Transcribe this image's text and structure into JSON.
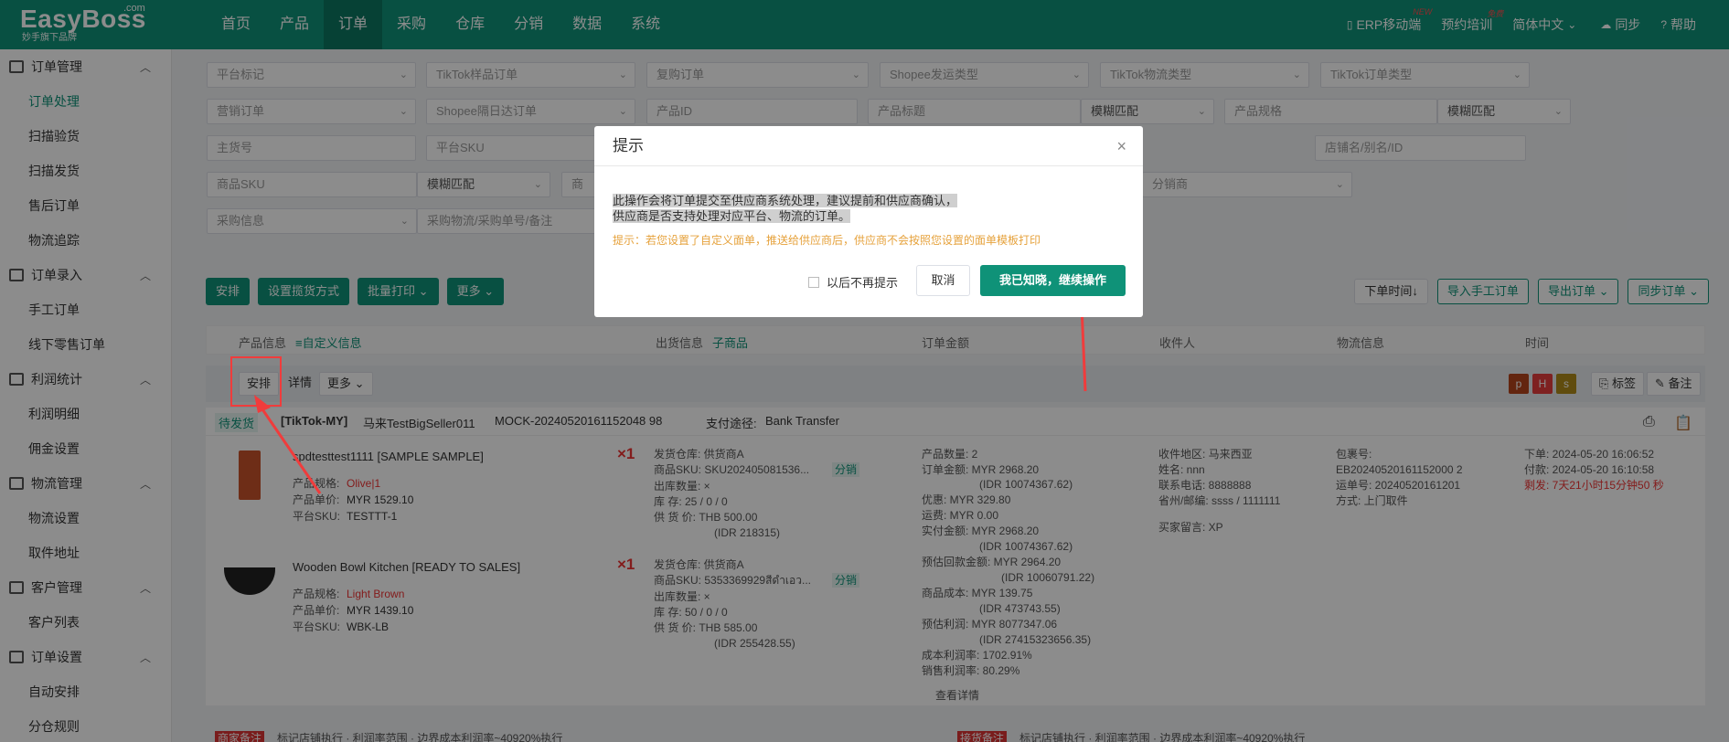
{
  "logo": {
    "name": "EasyBoss",
    "com": ".com",
    "sub": "妙手旗下品牌"
  },
  "nav": [
    "首页",
    "产品",
    "订单",
    "采购",
    "仓库",
    "分销",
    "数据",
    "系统"
  ],
  "topright": {
    "erp": "ERP移动端",
    "erp_badge": "NEW",
    "train": "预约培训",
    "train_badge": "免费",
    "lang": "简体中文",
    "sync": "同步",
    "help": "帮助"
  },
  "sidebar": [
    {
      "group": "订单管理",
      "items": [
        "订单处理",
        "扫描验货",
        "扫描发货",
        "售后订单",
        "物流追踪"
      ]
    },
    {
      "group": "订单录入",
      "items": [
        "手工订单",
        "线下零售订单"
      ]
    },
    {
      "group": "利润统计",
      "items": [
        "利润明细",
        "佣金设置"
      ]
    },
    {
      "group": "物流管理",
      "items": [
        "物流设置",
        "取件地址"
      ]
    },
    {
      "group": "客户管理",
      "items": [
        "客户列表"
      ]
    },
    {
      "group": "订单设置",
      "items": [
        "自动安排",
        "分仓规则"
      ]
    }
  ],
  "filters": {
    "r1": [
      "平台标记",
      "TikTok样品订单",
      "复购订单",
      "Shopee发运类型",
      "TikTok物流类型",
      "TikTok订单类型"
    ],
    "r2": [
      "营销订单",
      "Shopee隔日达订单",
      "产品ID",
      "产品标题",
      "模糊匹配",
      "产品规格",
      "模糊匹配"
    ],
    "r3": [
      "主货号",
      "平台SKU",
      "店铺名/别名/ID"
    ],
    "r4": [
      "商品SKU",
      "模糊匹配",
      "商",
      "分销商"
    ],
    "r5": [
      "采购信息",
      "采购物流/采购单号/备注"
    ]
  },
  "actions": [
    "安排",
    "设置揽货方式",
    "批量打印",
    "更多"
  ],
  "right_actions": [
    "下单时间↓",
    "导入手工订单",
    "导出订单",
    "同步订单"
  ],
  "table_head": {
    "product": "产品信息",
    "custom": "≡自定义信息",
    "ship": "出货信息",
    "sub": "子商品",
    "amount": "订单金额",
    "receiver": "收件人",
    "logistics": "物流信息",
    "time": "时间"
  },
  "row_buttons": {
    "arrange": "安排",
    "detail": "详情",
    "more": "更多",
    "label": "标签",
    "remark": "备注"
  },
  "tags": [
    {
      "t": "p",
      "c": "#b5441c"
    },
    {
      "t": "H",
      "c": "#e63c3c"
    },
    {
      "t": "s",
      "c": "#b08a1a"
    }
  ],
  "order": {
    "status": "待发货",
    "platform": "[TikTok-MY]",
    "seller": "马来TestBigSeller011",
    "id": "MOCK-20240520161152048 98",
    "pay_label": "支付途径:",
    "pay": "Bank Transfer"
  },
  "items": [
    {
      "title": "spdtesttest1111 [SAMPLE SAMPLE]",
      "qty": "×1",
      "spec_label": "产品规格:",
      "spec": "Olive|1",
      "price_label": "产品单价:",
      "price": "MYR 1529.10",
      "sku_label": "平台SKU:",
      "sku": "TESTTT-1",
      "ship": [
        "发货仓库: 供货商A",
        "商品SKU: SKU202405081536...",
        "出库数量: ×",
        "库 存: 25 / 0 / 0",
        "供 货 价: THB 500.00",
        "(IDR 218315)"
      ],
      "dist": "分销"
    },
    {
      "title": "Wooden Bowl Kitchen [READY TO SALES]",
      "qty": "×1",
      "spec_label": "产品规格:",
      "spec": "Light Brown",
      "price_label": "产品单价:",
      "price": "MYR 1439.10",
      "sku_label": "平台SKU:",
      "sku": "WBK-LB",
      "ship": [
        "发货仓库: 供货商A",
        "商品SKU: 5353369929สีดำเอว...",
        "出库数量: ×",
        "库 存: 50 / 0 / 0",
        "供 货 价: THB 585.00",
        "(IDR 255428.55)"
      ],
      "dist": "分销"
    }
  ],
  "amount": [
    "产品数量: 2",
    "订单金额: MYR 2968.20",
    "(IDR 10074367.62)",
    "优惠: MYR 329.80",
    "运费: MYR 0.00",
    "实付金额: MYR 2968.20",
    "(IDR 10074367.62)",
    "预估回款金额: MYR 2964.20",
    "(IDR 10060791.22)",
    "商品成本: MYR 139.75",
    "(IDR 473743.55)",
    "预估利润: MYR 8077347.06",
    "(IDR 27415323656.35)",
    "成本利润率: 1702.91%",
    "销售利润率: 80.29%",
    "查看详情"
  ],
  "receiver": [
    "收件地区: 马来西亚",
    "姓名: nnn",
    "联系电话: 8888888",
    "省州/邮编: ssss / 1111111",
    "买家留言: XP"
  ],
  "logistics": [
    "包裹号:",
    "EB20240520161152000 2",
    "运单号: 20240520161201",
    "方式: 上门取件"
  ],
  "times": [
    "下单: 2024-05-20 16:06:52",
    "付款: 2024-05-20 16:10:58",
    "剩发: 7天21小时15分钟50 秒"
  ],
  "bottom": {
    "left": "商家备注",
    "lefttxt": "标记店铺执行 · 利润率范围 · 边界成本利润率~40920%执行",
    "right": "接货备注",
    "righttxt": "标记店铺执行 · 利润率范围 · 边界成本利润率~40920%执行"
  },
  "modal": {
    "title": "提示",
    "close": "×",
    "line1": "此操作会将订单提交至供应商系统处理，建议提前和供应商确认，",
    "line2": "供应商是否支持处理对应平台、物流的订单。",
    "tip": "提示：若您设置了自定义面单，推送给供应商后，供应商不会按照您设置的面单模板打印",
    "check": "以后不再提示",
    "cancel": "取消",
    "ok": "我已知晓，继续操作"
  }
}
